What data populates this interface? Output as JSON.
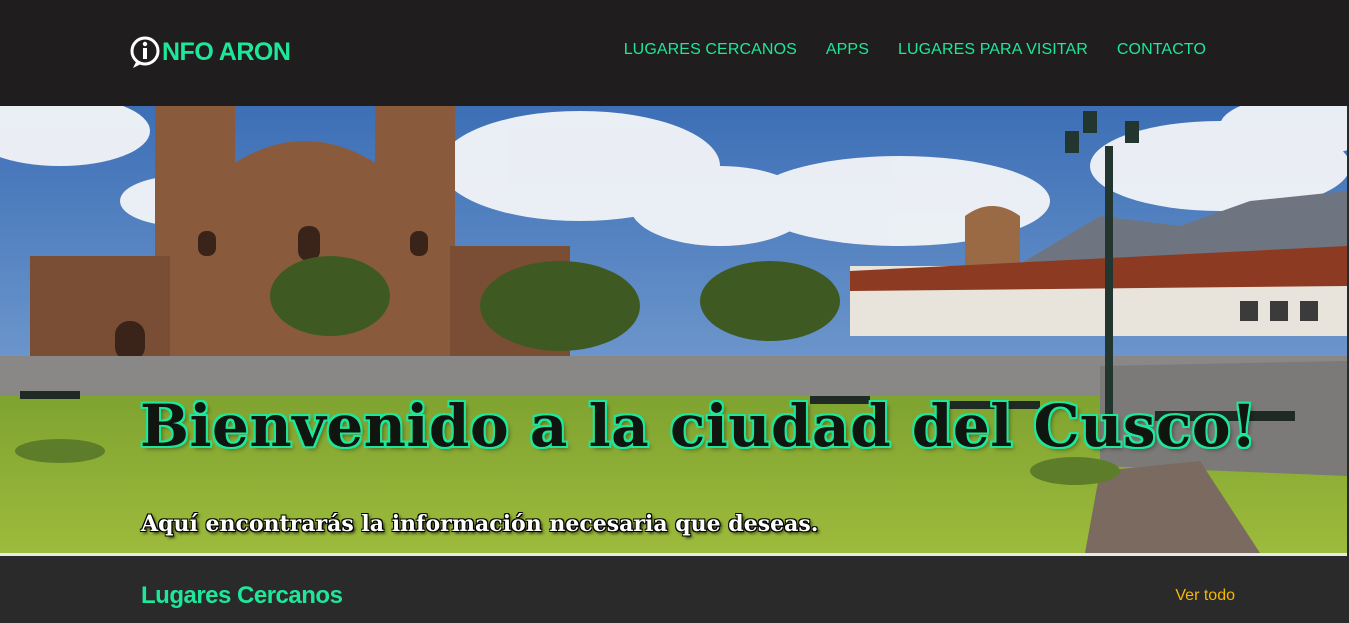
{
  "header": {
    "logo_text": "NFO ARON",
    "logo_icon": "info-circle-icon",
    "nav": [
      {
        "label": "LUGARES CERCANOS"
      },
      {
        "label": "APPS"
      },
      {
        "label": "LUGARES PARA VISITAR"
      },
      {
        "label": "CONTACTO"
      }
    ]
  },
  "hero": {
    "title": "Bienvenido a la ciudad del Cusco!",
    "subtitle": "Aquí encontrarás la información necesaria que deseas."
  },
  "section": {
    "title": "Lugares Cercanos",
    "see_all": "Ver todo"
  },
  "colors": {
    "accent": "#1ee79a",
    "link_yellow": "#f5b800",
    "header_bg": "#1f1d1d",
    "section_bg": "#2b2a2a"
  }
}
